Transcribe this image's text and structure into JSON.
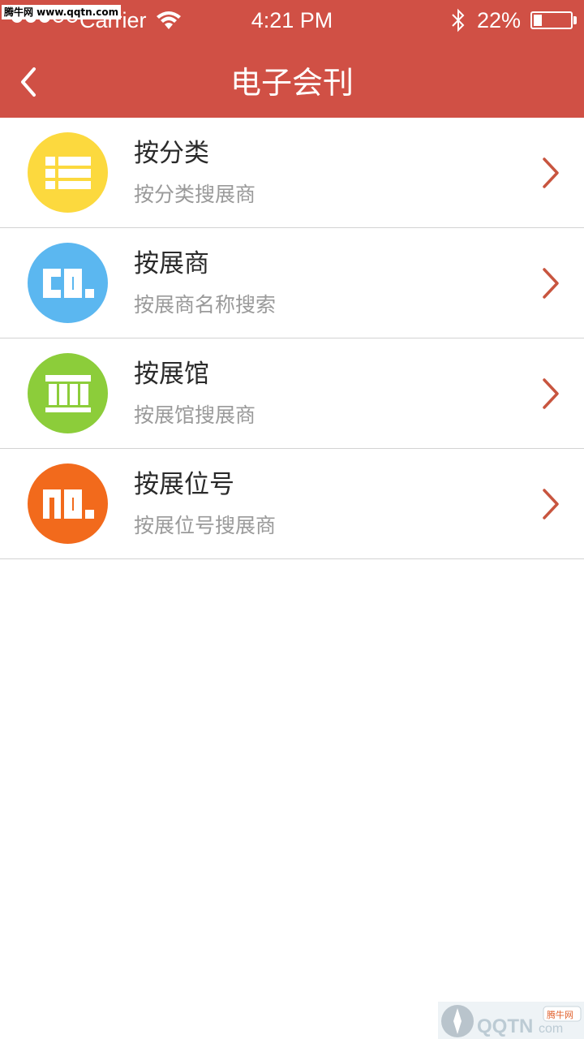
{
  "watermark": {
    "badge_text": "腾牛网 www.qqtn.com",
    "logo_text": "QQTN",
    "logo_suffix": "com",
    "logo_tag": "腾牛网"
  },
  "status_bar": {
    "carrier": "Carrier",
    "time": "4:21 PM",
    "battery_percent": "22%",
    "battery_level": 0.22,
    "signal_bars_filled": 3,
    "signal_bars_total": 5
  },
  "navbar": {
    "title": "电子会刊",
    "back_icon": "chevron-left-icon"
  },
  "menu": {
    "items": [
      {
        "title": "按分类",
        "subtitle": "按分类搜展商",
        "icon": "category-list-icon",
        "color": "#fcd93e"
      },
      {
        "title": "按展商",
        "subtitle": "按展商名称搜索",
        "icon": "company-co-icon",
        "color": "#5bb7f0"
      },
      {
        "title": "按展馆",
        "subtitle": "按展馆搜展商",
        "icon": "hall-building-icon",
        "color": "#8ccd3a"
      },
      {
        "title": "按展位号",
        "subtitle": "按展位号搜展商",
        "icon": "booth-number-icon",
        "color": "#f26a1c"
      }
    ]
  },
  "colors": {
    "header": "#d05045",
    "chevron": "#c8553f",
    "divider": "#d3d3d3"
  }
}
